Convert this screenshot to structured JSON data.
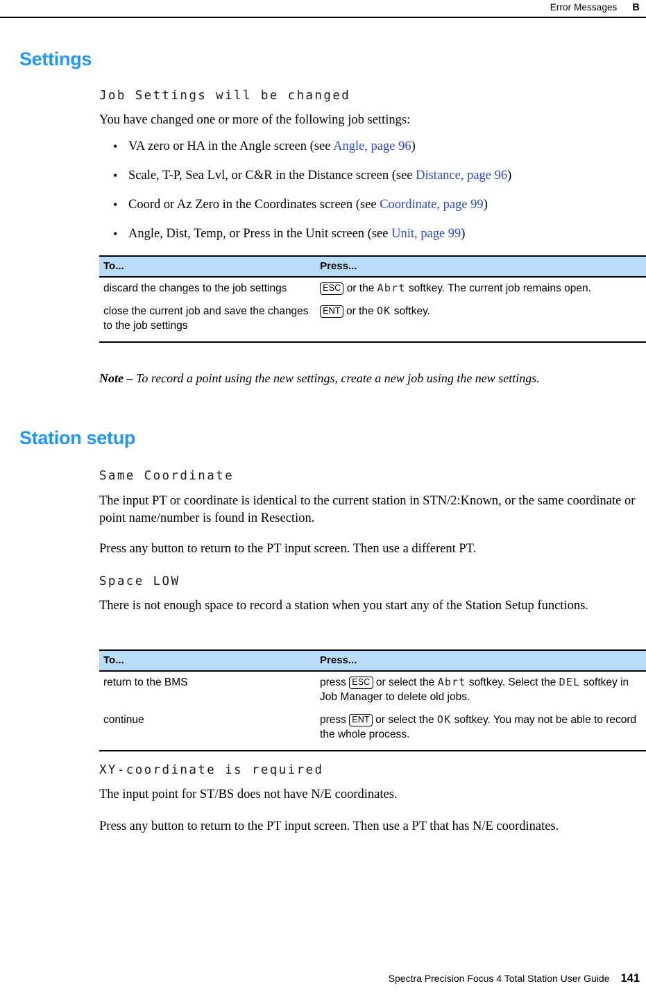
{
  "header": {
    "title": "Error Messages",
    "appendix": "B"
  },
  "sections": [
    {
      "heading": "Settings",
      "message": "Job Settings will be changed",
      "intro": "You have changed one or more of the following job settings:",
      "bullets": [
        {
          "mark": "•",
          "text": "VA zero or HA in the Angle screen (see ",
          "xref": "Angle, page 96",
          "tail": ")"
        },
        {
          "mark": "•",
          "text": "Scale, T-P, Sea Lvl, or C&R in the Distance screen (see ",
          "xref": "Distance, page 96",
          "tail": ")"
        },
        {
          "mark": "•",
          "text": "Coord or Az Zero in the Coordinates screen (see ",
          "xref": "Coordinate, page 99",
          "tail": ")"
        },
        {
          "mark": "•",
          "text": "Angle, Dist, Temp, or Press in the Unit screen (see ",
          "xref": "Unit, page 99",
          "tail": ")"
        }
      ]
    }
  ],
  "table_settings": {
    "columns": [
      "To...",
      "Press..."
    ],
    "rows": [
      {
        "to": "discard the changes to the job settings",
        "press_parts": [
          {
            "type": "keycap",
            "text": "ESC"
          },
          {
            "type": "text",
            "text": " or the "
          },
          {
            "type": "lcd",
            "text": "Abrt"
          },
          {
            "type": "text",
            "text": " softkey. The current job remains open."
          }
        ]
      },
      {
        "to": "close the current job and save the changes to the job settings",
        "press_parts": [
          {
            "type": "keycap",
            "text": "ENT"
          },
          {
            "type": "text",
            "text": " or the "
          },
          {
            "type": "lcd",
            "text": "OK"
          },
          {
            "type": "text",
            "text": " softkey."
          }
        ]
      }
    ]
  },
  "note": {
    "label": "Note – ",
    "text": "To record a point using the new settings, create a new job using the new settings."
  },
  "station": {
    "heading": "Station setup",
    "msg_same_coordinate": "Same Coordinate",
    "same_coordinate_body": "The input PT or coordinate is identical to the current station in STN/2:Known, or the same coordinate or point name/number is found in Resection.",
    "same_coordinate_action": "Press any button to return to the PT input screen. Then use a different PT.",
    "msg_space_low": "Space LOW",
    "space_low_body": "There is not enough space to record a station when you start any of the Station Setup functions.",
    "msg_xy_required": "XY-coordinate is required",
    "xy_body": "The input point for ST/BS does not have N/E coordinates.",
    "xy_action": "Press any button to return to the PT input screen. Then use a PT that has N/E coordinates."
  },
  "table_station": {
    "columns": [
      "To...",
      "Press..."
    ],
    "rows": [
      {
        "to": "return to the BMS",
        "press_parts": [
          {
            "type": "text",
            "text": "press "
          },
          {
            "type": "keycap",
            "text": "ESC"
          },
          {
            "type": "text",
            "text": " or select the "
          },
          {
            "type": "lcd",
            "text": "Abrt"
          },
          {
            "type": "text",
            "text": " softkey. Select the "
          },
          {
            "type": "lcd",
            "text": "DEL"
          },
          {
            "type": "text",
            "text": " softkey in Job Manager to delete old jobs."
          }
        ]
      },
      {
        "to": "continue",
        "press_parts": [
          {
            "type": "text",
            "text": "press "
          },
          {
            "type": "keycap",
            "text": "ENT"
          },
          {
            "type": "text",
            "text": " or select the "
          },
          {
            "type": "lcd",
            "text": "OK"
          },
          {
            "type": "text",
            "text": " softkey. You may not be able to record the whole process."
          }
        ]
      }
    ]
  },
  "footer": {
    "guide": "Spectra Precision Focus 4 Total Station User Guide",
    "page": "141"
  },
  "colors": {
    "heading_blue": "#2196F3",
    "xref_blue": "#2D49CE",
    "table_header_bg": "#B9DCFB"
  }
}
